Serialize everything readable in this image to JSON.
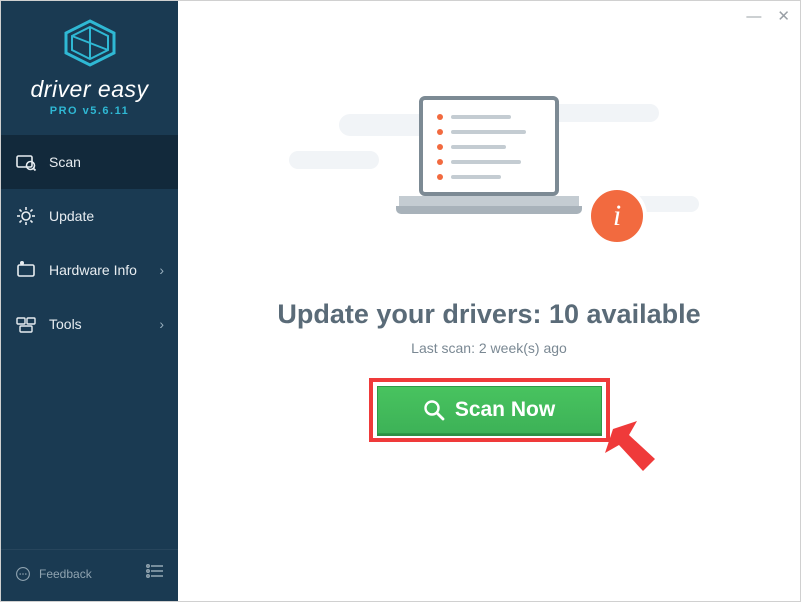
{
  "brand": {
    "name": "driver easy",
    "version_label": "PRO v5.6.11"
  },
  "sidebar": {
    "items": [
      {
        "label": "Scan"
      },
      {
        "label": "Update"
      },
      {
        "label": "Hardware Info"
      },
      {
        "label": "Tools"
      }
    ],
    "feedback_label": "Feedback"
  },
  "main": {
    "heading_prefix": "Update your drivers: ",
    "available_count": "10",
    "heading_suffix": " available",
    "last_scan": "Last scan: 2 week(s) ago",
    "scan_button": "Scan Now"
  },
  "titlebar": {
    "minimize": "—",
    "close": "✕"
  }
}
